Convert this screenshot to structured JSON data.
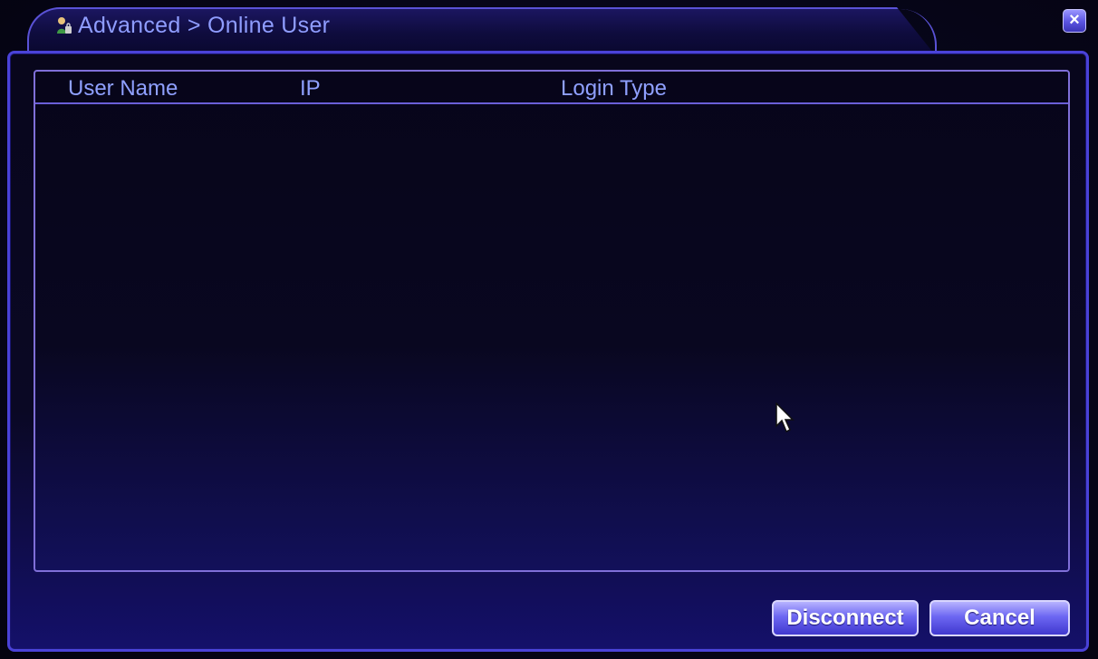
{
  "window": {
    "title": "Advanced > Online User",
    "title_icon": "user-online-icon",
    "close_label": "×"
  },
  "table": {
    "columns": [
      "User Name",
      "IP",
      "Login Type"
    ],
    "rows": []
  },
  "buttons": {
    "disconnect_label": "Disconnect",
    "cancel_label": "Cancel"
  },
  "colors": {
    "accent": "#4a42d8",
    "title_text": "#8f9dff",
    "button_gradient_top": "#b7b3ff",
    "button_gradient_bottom": "#4038cf"
  }
}
